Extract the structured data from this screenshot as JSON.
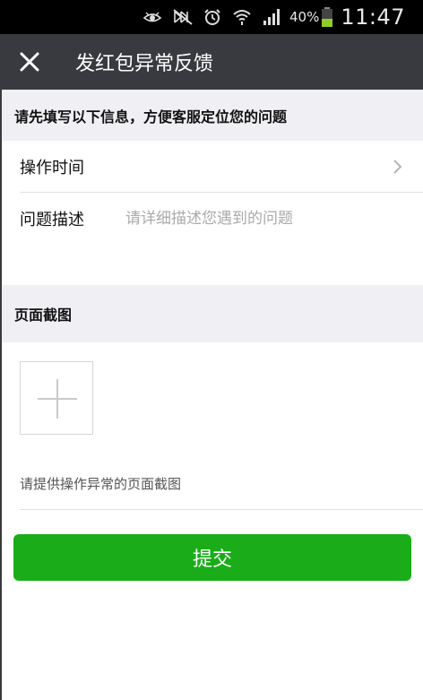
{
  "status_bar": {
    "battery_percent": "40%",
    "time": "11:47",
    "icons": [
      "eye-icon",
      "mute-icon",
      "alarm-icon",
      "wifi-icon",
      "signal-icon",
      "battery-icon"
    ]
  },
  "header": {
    "title": "发红包异常反馈",
    "close_icon": "close-icon"
  },
  "form": {
    "intro": "请先填写以下信息，方便客服定位您的问题",
    "rows": [
      {
        "label": "操作时间",
        "value": ""
      },
      {
        "label": "问题描述",
        "placeholder": "请详细描述您遇到的问题"
      }
    ]
  },
  "screenshot_section": {
    "title": "页面截图",
    "hint": "请提供操作异常的页面截图"
  },
  "submit_label": "提交",
  "colors": {
    "title_bar": "#393a3f",
    "section_bg": "#efeff4",
    "primary_green": "#1aad19"
  }
}
